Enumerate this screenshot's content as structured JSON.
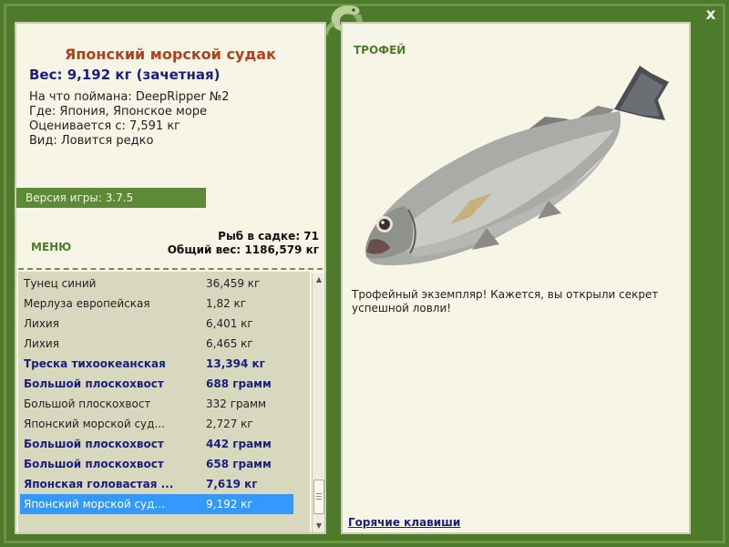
{
  "window": {
    "close_label": "x",
    "accent_color": "#4e7a2c",
    "icons": {
      "logo": "lizard-logo-icon",
      "close": "close-icon"
    }
  },
  "fish_info": {
    "title": "Японский морской судак",
    "weight": "Вес: 9,192 кг (зачетная)",
    "lines": [
      "На что поймана: DeepRipper №2",
      "Где: Япония, Японское море",
      "Оценивается с: 7,591 кг",
      "Вид: Ловится редко"
    ]
  },
  "version": "Версия игры: 3.7.5",
  "menu_label": "МЕНЮ",
  "stats": {
    "fish_count": "Рыб в садке: 71",
    "total_weight": "Общий вес: 1186,579 кг"
  },
  "catch_list": [
    {
      "name": "Тунец синий",
      "weight": "36,459 кг",
      "bold": false
    },
    {
      "name": "Мерлуза европейская",
      "weight": "1,82 кг",
      "bold": false
    },
    {
      "name": "Лихия",
      "weight": "6,401 кг",
      "bold": false
    },
    {
      "name": "Лихия",
      "weight": "6,465 кг",
      "bold": false
    },
    {
      "name": "Треска тихоокеанская",
      "weight": "13,394 кг",
      "bold": true
    },
    {
      "name": "Большой плоскохвост",
      "weight": "688 грамм",
      "bold": true
    },
    {
      "name": "Большой плоскохвост",
      "weight": "332 грамм",
      "bold": false
    },
    {
      "name": "Японский морской суд...",
      "weight": "2,727 кг",
      "bold": false
    },
    {
      "name": "Большой плоскохвост",
      "weight": "442 грамм",
      "bold": true
    },
    {
      "name": "Большой плоскохвост",
      "weight": "658 грамм",
      "bold": true
    },
    {
      "name": "Японская головастая ...",
      "weight": "7,619 кг",
      "bold": true
    },
    {
      "name": "Японский морской суд...",
      "weight": "9,192 кг",
      "bold": false,
      "selected": true
    }
  ],
  "trophy": {
    "label": "ТРОФЕЙ",
    "description": "Трофейный экземпляр! Кажется, вы открыли секрет успешной ловли!"
  },
  "hotkeys_label": "Горячие клавиши"
}
